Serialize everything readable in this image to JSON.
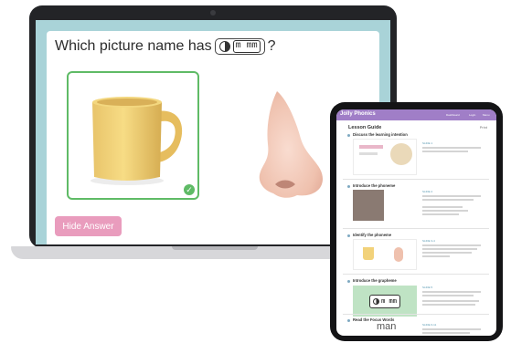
{
  "laptop": {
    "question_text": "Which picture name has",
    "question_mark": "?",
    "chip_text": "m mm",
    "hide_button_label": "Hide Answer",
    "check_symbol": "✓",
    "accent_green": "#5fbb66",
    "accent_pink": "#e99cbd",
    "screen_bg": "#a9d3d8"
  },
  "tablet": {
    "logo": "Jolly Phonics",
    "nav_items": [
      "Dashboard",
      "Login",
      "Menu"
    ],
    "page_title": "Lesson Guide",
    "print_label": "Print",
    "sections": [
      {
        "title": "Discuss the learning intention",
        "tag": "SLIDE 1"
      },
      {
        "title": "Introduce the phoneme",
        "tag": "SLIDE 2"
      },
      {
        "title": "Identify the phoneme",
        "tag": "SLIDE 3-4"
      },
      {
        "title": "Introduce the grapheme",
        "tag": "SLIDE 5"
      },
      {
        "title": "Read the Focus Words",
        "tag": "SLIDE 6-11"
      }
    ],
    "grapheme_chip": "m mm",
    "focus_word": "man",
    "accent_purple": "#a07ec7"
  }
}
